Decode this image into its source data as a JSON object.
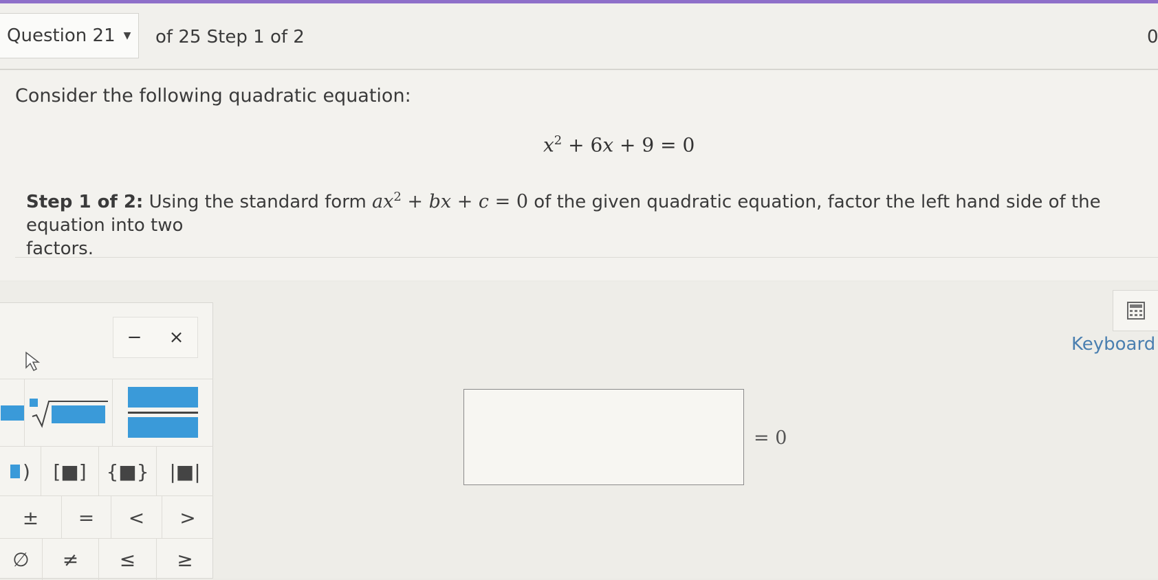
{
  "header": {
    "question_label": "Question 21",
    "progress_text": "of 25 Step 1 of 2",
    "corner_text": "0"
  },
  "question": {
    "prompt": "Consider the following quadratic equation:",
    "equation": {
      "lhs_parts": [
        "x",
        "2",
        " + 6",
        "x",
        " + 9 = 0"
      ]
    },
    "step_label": "Step 1 of 2:",
    "step_text_before": " Using the standard form ",
    "standard_form": {
      "a": "ax",
      "exp": "2",
      "rest_b": " + ",
      "b": "bx",
      "rest_c": " + ",
      "c": "c",
      "tail": " = 0"
    },
    "step_text_after": " of the given quadratic equation, factor the left hand side of the equation into two",
    "step_text_line2": "factors."
  },
  "palette": {
    "minimize_label": "−",
    "close_label": "×",
    "row3": [
      ")",
      "[■]",
      "{■}",
      "|■|"
    ],
    "row4": [
      "±",
      "=",
      "<",
      ">"
    ],
    "row5": [
      "∅",
      "≠",
      "≤",
      "≥"
    ]
  },
  "answer": {
    "equals_text": "= 0"
  },
  "tools": {
    "keyboard_label": "Keyboard S"
  },
  "colors": {
    "accent_bar": "#8e6fc9",
    "palette_blue": "#3a9ad9",
    "link": "#4a7fb0"
  }
}
